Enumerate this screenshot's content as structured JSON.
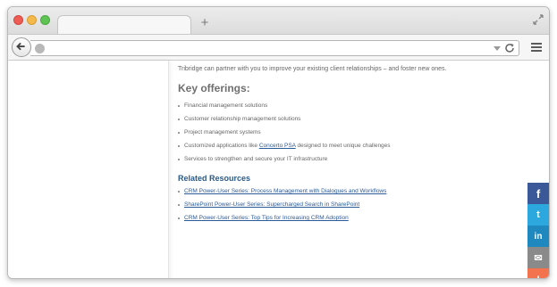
{
  "browser": {
    "new_tab_symbol": "+"
  },
  "page": {
    "intro": "Tribridge can partner with you to improve your existing client relationships – and foster new ones.",
    "key_offerings_heading": "Key offerings:",
    "offerings": [
      "Financial management solutions",
      "Customer relationship management solutions",
      "Project management systems",
      {
        "prefix": "Customized applications like ",
        "link": "Concerto PSA",
        "suffix": " designed to meet unique challenges"
      },
      "Services to strengthen and secure your IT infrastructure"
    ],
    "related_heading": "Related Resources",
    "related_links": [
      "CRM Power-User Series: Process Management with Dialogues and Workflows",
      "SharePoint Power-User Series: Supercharged Search in SharePoint",
      "CRM Power-User Series: Top Tips for Increasing CRM Adoption"
    ]
  },
  "share": {
    "facebook": "f",
    "twitter": "t",
    "linkedin": "in",
    "email": "✉",
    "more": "+"
  },
  "colors": {
    "facebook": "#3b5998",
    "twitter": "#2ca8de",
    "linkedin": "#1f88be",
    "email": "#8a8a8a",
    "more": "#f2734d",
    "link": "#2a5a9a"
  }
}
